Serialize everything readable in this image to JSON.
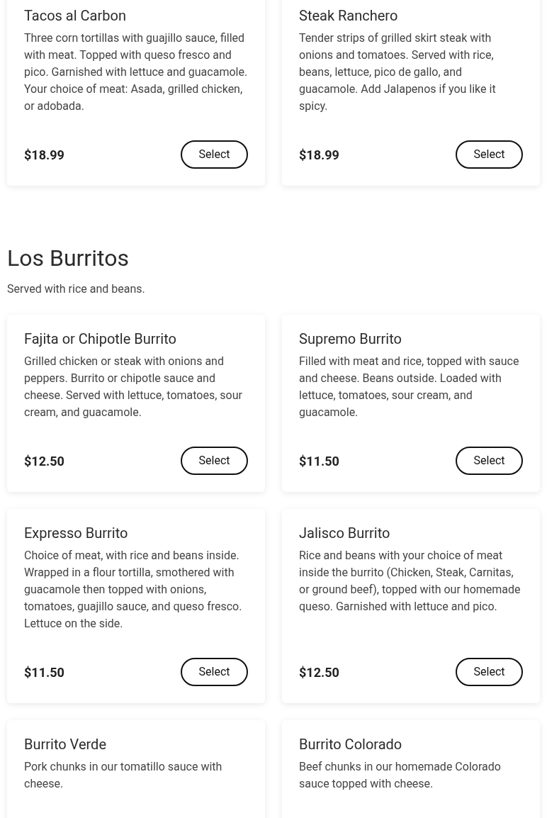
{
  "sections": [
    {
      "items": [
        {
          "name": "Tacos al Carbon",
          "description": "Three corn tortillas with guajillo sauce, filled with meat. Topped with queso fresco and pico. Garnished with lettuce and guacamole. Your choice of meat: Asada, grilled chicken, or adobada.",
          "price": "$18.99",
          "button": "Select"
        },
        {
          "name": "Steak Ranchero",
          "description": "Tender strips of grilled skirt steak with onions and tomatoes. Served with rice, beans, lettuce, pico de gallo, and guacamole. Add Jalapenos if you like it spicy.",
          "price": "$18.99",
          "button": "Select"
        }
      ]
    },
    {
      "title": "Los Burritos",
      "subtitle": "Served with rice and beans.",
      "items": [
        {
          "name": "Fajita or Chipotle Burrito",
          "description": "Grilled chicken or steak with onions and peppers. Burrito or chipotle sauce and cheese. Served with lettuce, tomatoes, sour cream, and guacamole.",
          "price": "$12.50",
          "button": "Select"
        },
        {
          "name": "Supremo Burrito",
          "description": "Filled with meat and rice, topped with sauce and cheese. Beans outside. Loaded with lettuce, tomatoes, sour cream, and guacamole.",
          "price": "$11.50",
          "button": "Select"
        },
        {
          "name": "Expresso Burrito",
          "description": "Choice of meat, with rice and beans inside. Wrapped in a flour tortilla, smothered with guacamole then topped with onions, tomatoes, guajillo sauce, and queso fresco. Lettuce on the side.",
          "price": "$11.50",
          "button": "Select"
        },
        {
          "name": "Jalisco Burrito",
          "description": "Rice and beans with your choice of meat inside the burrito (Chicken, Steak, Carnitas, or ground beef), topped with our homemade queso. Garnished with lettuce and pico.",
          "price": "$12.50",
          "button": "Select"
        },
        {
          "name": "Burrito Verde",
          "description": "Pork chunks in our tomatillo sauce with cheese."
        },
        {
          "name": "Burrito Colorado",
          "description": "Beef chunks in our homemade Colorado sauce topped with cheese."
        }
      ]
    }
  ]
}
